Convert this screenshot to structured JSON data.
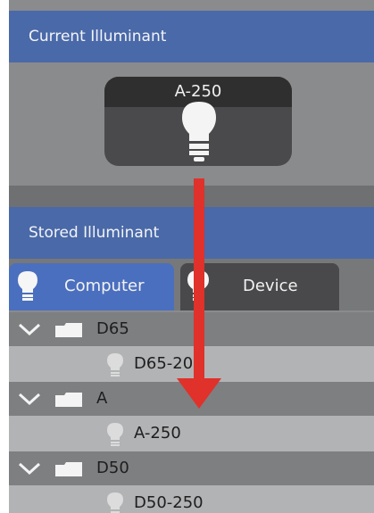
{
  "current": {
    "header": "Current Illuminant",
    "illuminant_label": "A-250",
    "icon": "lightbulb-icon"
  },
  "stored": {
    "header": "Stored Illuminant",
    "tabs": [
      {
        "label": "Computer",
        "icon": "lightbulb-icon",
        "active": true
      },
      {
        "label": "Device",
        "icon": "lightbulb-icon",
        "active": false
      }
    ],
    "tree": [
      {
        "folder": "D65",
        "items": [
          "D65-200"
        ]
      },
      {
        "folder": "A",
        "items": [
          "A-250"
        ]
      },
      {
        "folder": "D50",
        "items": [
          "D50-250"
        ]
      }
    ]
  },
  "annotation": {
    "arrow_color": "#e0312b",
    "direction": "down"
  },
  "colors": {
    "header_blue": "#4a69a8",
    "active_tab_blue": "#4b6fbf",
    "panel_gray": "#8a8b8d"
  }
}
